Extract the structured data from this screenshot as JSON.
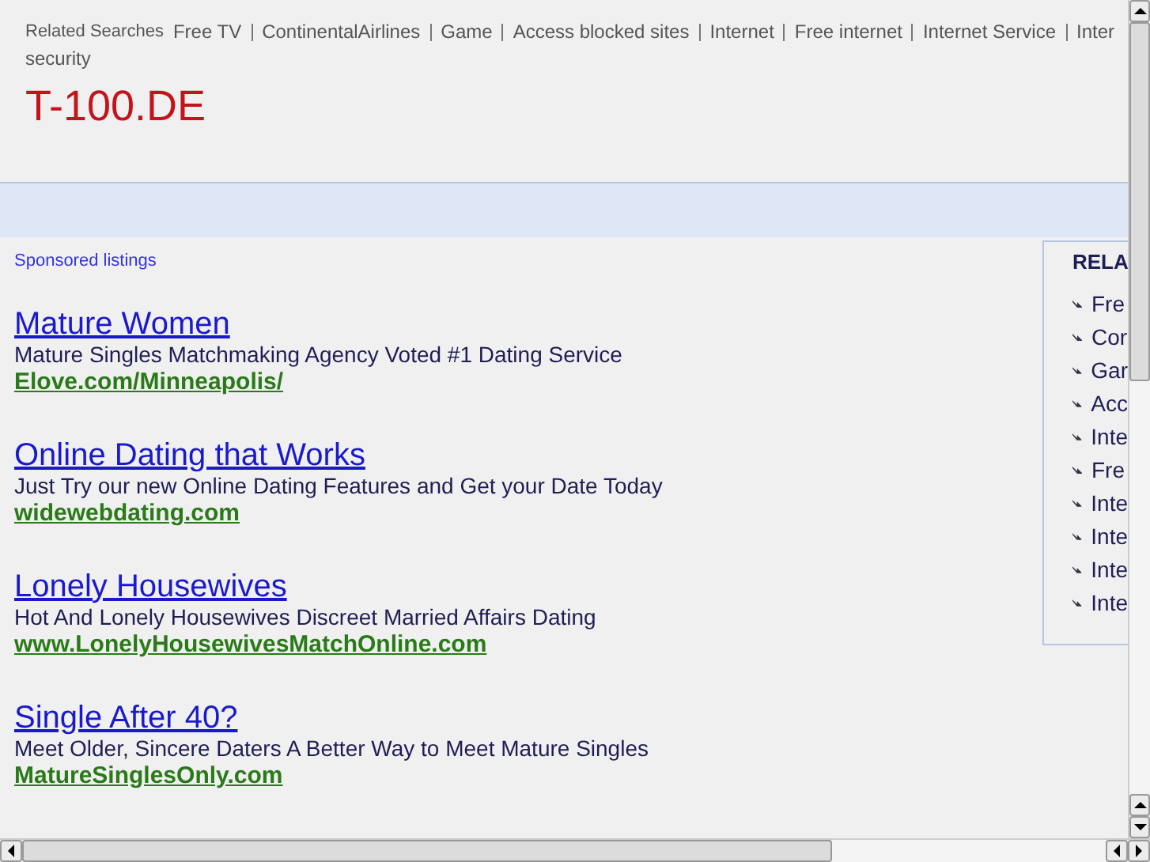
{
  "related_searches": {
    "label": "Related Searches",
    "items": [
      "Free TV",
      "ContinentalAirlines",
      "Game",
      "Access blocked sites",
      "Internet",
      "Free internet",
      "Internet Service",
      "Inter"
    ],
    "continued": "security"
  },
  "site_title": "T-100.DE",
  "sponsored_label": "Sponsored listings",
  "ads": [
    {
      "title": "Mature Women",
      "description": "Mature Singles Matchmaking Agency Voted #1 Dating Service",
      "url": "Elove.com/Minneapolis/"
    },
    {
      "title": "Online Dating that Works",
      "description": "Just Try our new Online Dating Features and Get your Date Today",
      "url": "widewebdating.com"
    },
    {
      "title": "Lonely Housewives",
      "description": "Hot And Lonely Housewives Discreet Married Affairs Dating",
      "url": "www.LonelyHousewivesMatchOnline.com"
    },
    {
      "title": "Single After 40?",
      "description": "Meet Older, Sincere Daters A Better Way to Meet Mature Singles",
      "url": "MatureSinglesOnly.com"
    }
  ],
  "sidebar": {
    "heading": "RELA",
    "items": [
      "Fre",
      "Cor",
      "Gar",
      "Acc",
      "Inte",
      "Fre",
      "Inte",
      "Inte",
      "Inte",
      "Inte"
    ]
  }
}
